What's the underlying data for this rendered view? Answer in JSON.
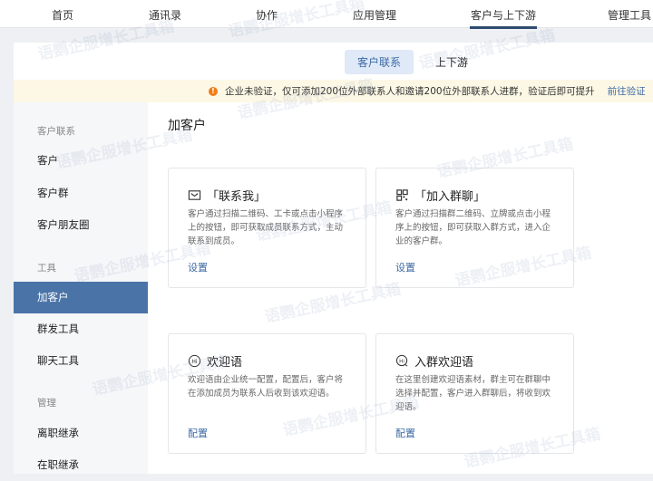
{
  "topnav": [
    "首页",
    "通讯录",
    "协作",
    "应用管理",
    "客户与上下游",
    "管理工具"
  ],
  "subtabs": [
    "客户联系",
    "上下游"
  ],
  "banner": {
    "text": "企业未验证，仅可添加200位外部联系人和邀请200位外部联系人进群，验证后即可提升",
    "link": "前往验证"
  },
  "sidebar": {
    "sec1": "客户联系",
    "items1": [
      "客户",
      "客户群",
      "客户朋友圈"
    ],
    "sec2": "工具",
    "items2": [
      "加客户",
      "群发工具",
      "聊天工具"
    ],
    "sec3": "管理",
    "items3": [
      "离职继承",
      "在职继承"
    ]
  },
  "page_title": "加客户",
  "cards": [
    {
      "title": "「联系我」",
      "desc": "客户通过扫描二维码、工卡或点击小程序上的按钮，即可获取成员联系方式，主动联系到成员。",
      "link": "设置"
    },
    {
      "title": "「加入群聊」",
      "desc": "客户通过扫描群二维码、立牌或点击小程序上的按钮，即可获取入群方式，进入企业的客户群。",
      "link": "设置"
    },
    {
      "title": "欢迎语",
      "desc": "欢迎语由企业统一配置，配置后，客户将在添加成员为联系人后收到该欢迎语。",
      "link": "配置"
    },
    {
      "title": "入群欢迎语",
      "desc": "在这里创建欢迎语素材，群主可在群聊中选择并配置，客户进入群聊后，将收到欢迎语。",
      "link": "配置"
    }
  ],
  "watermark": "语鹦企服增长工具箱",
  "colors": {
    "accent": "#4a74a8",
    "link": "#3d6aa5",
    "warning": "#f07c1a"
  }
}
